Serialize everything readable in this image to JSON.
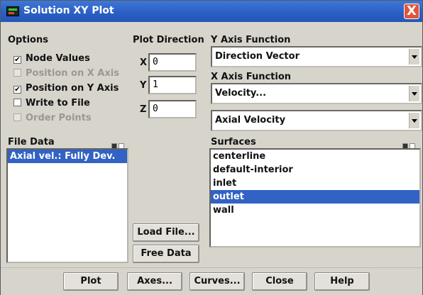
{
  "window": {
    "title": "Solution XY Plot",
    "close_glyph": "X"
  },
  "options": {
    "heading": "Options",
    "items": [
      {
        "label": "Node Values",
        "checked": true,
        "enabled": true
      },
      {
        "label": "Position on X Axis",
        "checked": false,
        "enabled": false
      },
      {
        "label": "Position on Y Axis",
        "checked": true,
        "enabled": true
      },
      {
        "label": "Write to File",
        "checked": false,
        "enabled": true
      },
      {
        "label": "Order Points",
        "checked": false,
        "enabled": false
      }
    ]
  },
  "plot_direction": {
    "heading": "Plot Direction",
    "x_label": "X",
    "x_value": "0",
    "y_label": "Y",
    "y_value": "1",
    "z_label": "Z",
    "z_value": "0"
  },
  "y_axis_function": {
    "heading": "Y Axis Function",
    "value": "Direction Vector"
  },
  "x_axis_function": {
    "heading": "X Axis Function",
    "category": "Velocity...",
    "value": "Axial Velocity"
  },
  "file_data": {
    "heading": "File Data",
    "items": [
      "Axial vel.: Fully Dev."
    ],
    "selected_index": 0
  },
  "surfaces": {
    "heading": "Surfaces",
    "items": [
      "centerline",
      "default-interior",
      "inlet",
      "outlet",
      "wall"
    ],
    "selected_index": 3
  },
  "side_buttons": {
    "load_file": "Load File...",
    "free_data": "Free Data"
  },
  "bottom_buttons": {
    "plot": "Plot",
    "axes": "Axes...",
    "curves": "Curves...",
    "close": "Close",
    "help": "Help"
  },
  "colors": {
    "titlebar": "#2b5fc4",
    "selection": "#3162c4",
    "panel": "#d7d4cc",
    "close": "#e0553a"
  }
}
